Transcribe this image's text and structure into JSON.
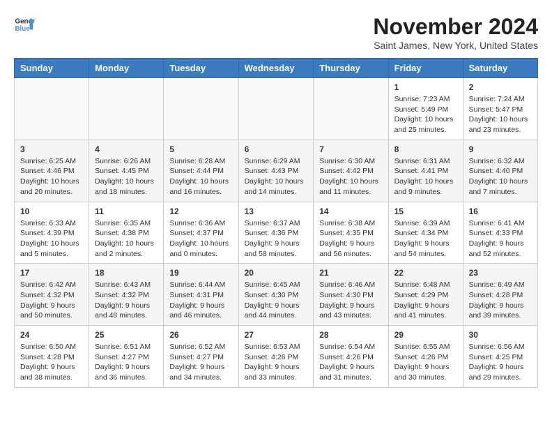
{
  "header": {
    "logo_line1": "General",
    "logo_line2": "Blue",
    "month": "November 2024",
    "location": "Saint James, New York, United States"
  },
  "days_of_week": [
    "Sunday",
    "Monday",
    "Tuesday",
    "Wednesday",
    "Thursday",
    "Friday",
    "Saturday"
  ],
  "weeks": [
    [
      {
        "day": "",
        "info": ""
      },
      {
        "day": "",
        "info": ""
      },
      {
        "day": "",
        "info": ""
      },
      {
        "day": "",
        "info": ""
      },
      {
        "day": "",
        "info": ""
      },
      {
        "day": "1",
        "info": "Sunrise: 7:23 AM\nSunset: 5:49 PM\nDaylight: 10 hours and 25 minutes."
      },
      {
        "day": "2",
        "info": "Sunrise: 7:24 AM\nSunset: 5:47 PM\nDaylight: 10 hours and 23 minutes."
      }
    ],
    [
      {
        "day": "3",
        "info": "Sunrise: 6:25 AM\nSunset: 4:46 PM\nDaylight: 10 hours and 20 minutes."
      },
      {
        "day": "4",
        "info": "Sunrise: 6:26 AM\nSunset: 4:45 PM\nDaylight: 10 hours and 18 minutes."
      },
      {
        "day": "5",
        "info": "Sunrise: 6:28 AM\nSunset: 4:44 PM\nDaylight: 10 hours and 16 minutes."
      },
      {
        "day": "6",
        "info": "Sunrise: 6:29 AM\nSunset: 4:43 PM\nDaylight: 10 hours and 14 minutes."
      },
      {
        "day": "7",
        "info": "Sunrise: 6:30 AM\nSunset: 4:42 PM\nDaylight: 10 hours and 11 minutes."
      },
      {
        "day": "8",
        "info": "Sunrise: 6:31 AM\nSunset: 4:41 PM\nDaylight: 10 hours and 9 minutes."
      },
      {
        "day": "9",
        "info": "Sunrise: 6:32 AM\nSunset: 4:40 PM\nDaylight: 10 hours and 7 minutes."
      }
    ],
    [
      {
        "day": "10",
        "info": "Sunrise: 6:33 AM\nSunset: 4:39 PM\nDaylight: 10 hours and 5 minutes."
      },
      {
        "day": "11",
        "info": "Sunrise: 6:35 AM\nSunset: 4:38 PM\nDaylight: 10 hours and 2 minutes."
      },
      {
        "day": "12",
        "info": "Sunrise: 6:36 AM\nSunset: 4:37 PM\nDaylight: 10 hours and 0 minutes."
      },
      {
        "day": "13",
        "info": "Sunrise: 6:37 AM\nSunset: 4:36 PM\nDaylight: 9 hours and 58 minutes."
      },
      {
        "day": "14",
        "info": "Sunrise: 6:38 AM\nSunset: 4:35 PM\nDaylight: 9 hours and 56 minutes."
      },
      {
        "day": "15",
        "info": "Sunrise: 6:39 AM\nSunset: 4:34 PM\nDaylight: 9 hours and 54 minutes."
      },
      {
        "day": "16",
        "info": "Sunrise: 6:41 AM\nSunset: 4:33 PM\nDaylight: 9 hours and 52 minutes."
      }
    ],
    [
      {
        "day": "17",
        "info": "Sunrise: 6:42 AM\nSunset: 4:32 PM\nDaylight: 9 hours and 50 minutes."
      },
      {
        "day": "18",
        "info": "Sunrise: 6:43 AM\nSunset: 4:32 PM\nDaylight: 9 hours and 48 minutes."
      },
      {
        "day": "19",
        "info": "Sunrise: 6:44 AM\nSunset: 4:31 PM\nDaylight: 9 hours and 46 minutes."
      },
      {
        "day": "20",
        "info": "Sunrise: 6:45 AM\nSunset: 4:30 PM\nDaylight: 9 hours and 44 minutes."
      },
      {
        "day": "21",
        "info": "Sunrise: 6:46 AM\nSunset: 4:30 PM\nDaylight: 9 hours and 43 minutes."
      },
      {
        "day": "22",
        "info": "Sunrise: 6:48 AM\nSunset: 4:29 PM\nDaylight: 9 hours and 41 minutes."
      },
      {
        "day": "23",
        "info": "Sunrise: 6:49 AM\nSunset: 4:28 PM\nDaylight: 9 hours and 39 minutes."
      }
    ],
    [
      {
        "day": "24",
        "info": "Sunrise: 6:50 AM\nSunset: 4:28 PM\nDaylight: 9 hours and 38 minutes."
      },
      {
        "day": "25",
        "info": "Sunrise: 6:51 AM\nSunset: 4:27 PM\nDaylight: 9 hours and 36 minutes."
      },
      {
        "day": "26",
        "info": "Sunrise: 6:52 AM\nSunset: 4:27 PM\nDaylight: 9 hours and 34 minutes."
      },
      {
        "day": "27",
        "info": "Sunrise: 6:53 AM\nSunset: 4:26 PM\nDaylight: 9 hours and 33 minutes."
      },
      {
        "day": "28",
        "info": "Sunrise: 6:54 AM\nSunset: 4:26 PM\nDaylight: 9 hours and 31 minutes."
      },
      {
        "day": "29",
        "info": "Sunrise: 6:55 AM\nSunset: 4:26 PM\nDaylight: 9 hours and 30 minutes."
      },
      {
        "day": "30",
        "info": "Sunrise: 6:56 AM\nSunset: 4:25 PM\nDaylight: 9 hours and 29 minutes."
      }
    ]
  ]
}
